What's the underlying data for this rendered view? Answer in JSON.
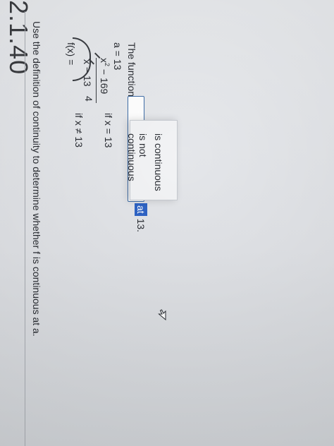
{
  "header": {
    "fragment": "2.1.40"
  },
  "question": {
    "prompt": "Use the definition of continuity to determine whether f is continuous at a.",
    "fx_label": "f(x) =",
    "case1": {
      "numerator_base": "x",
      "numerator_exp": "2",
      "numerator_tail": " − 169",
      "denominator": "x − 13",
      "condition": "if x ≠ 13"
    },
    "case2": {
      "value": "4",
      "condition": "if x = 13"
    },
    "a_line": "a = 13"
  },
  "answer": {
    "prefix": "The function",
    "select_value": "",
    "suffix_highlight": "at",
    "suffix_tail": " 13.",
    "options": [
      "is continuous",
      "is not continuous"
    ]
  },
  "colors": {
    "accent": "#2f64c5",
    "select_border": "#3f6ea8"
  }
}
